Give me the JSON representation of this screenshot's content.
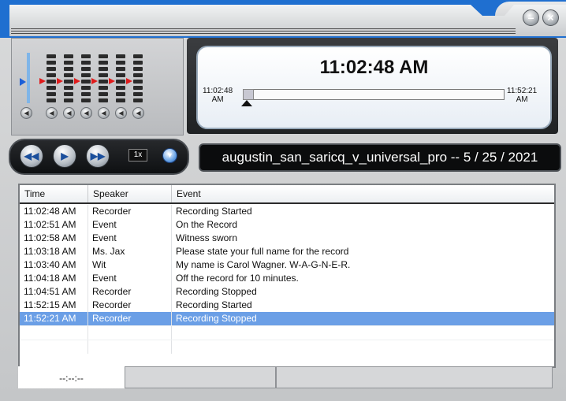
{
  "window": {
    "minimize_label": "–",
    "close_label": "×"
  },
  "clock": {
    "current_time": "11:02:48 AM",
    "range_start_time": "11:02:48",
    "range_start_ampm": "AM",
    "range_end_time": "11:52:21",
    "range_end_ampm": "AM",
    "playback_progress": 0.0
  },
  "transport": {
    "rewind_icon": "rewind-icon",
    "play_icon": "play-icon",
    "fast_forward_icon": "fast-forward-icon",
    "speed": "1x",
    "dropdown_icon": "chevron-down-icon"
  },
  "case_title": "augustin_san_saricq_v_universal_pro  --  5 / 25 / 2021",
  "table": {
    "columns": [
      "Time",
      "Speaker",
      "Event"
    ],
    "rows": [
      {
        "time": "11:02:48 AM",
        "speaker": "Recorder",
        "event": "Recording Started"
      },
      {
        "time": "11:02:51 AM",
        "speaker": "Event",
        "event": "On the Record"
      },
      {
        "time": "11:02:58 AM",
        "speaker": "Event",
        "event": "Witness sworn"
      },
      {
        "time": "11:03:18 AM",
        "speaker": "Ms. Jax",
        "event": "Please state your full name for the record"
      },
      {
        "time": "11:03:40 AM",
        "speaker": "Wit",
        "event": "My name is Carol Wagner. W-A-G-N-E-R."
      },
      {
        "time": "11:04:18 AM",
        "speaker": "Event",
        "event": "Off the record for 10 minutes."
      },
      {
        "time": "11:04:51 AM",
        "speaker": "Recorder",
        "event": "Recording Stopped"
      },
      {
        "time": "11:52:15 AM",
        "speaker": "Recorder",
        "event": "Recording Started"
      },
      {
        "time": "11:52:21 AM",
        "speaker": "Recorder",
        "event": "Recording Stopped"
      }
    ],
    "selected_index": 8
  },
  "status": {
    "time_readout": "--:--:--"
  },
  "colors": {
    "selection": "#6b9fe6",
    "fader_arrow": "#e01b1b",
    "master_arrow": "#1c5fd8"
  }
}
